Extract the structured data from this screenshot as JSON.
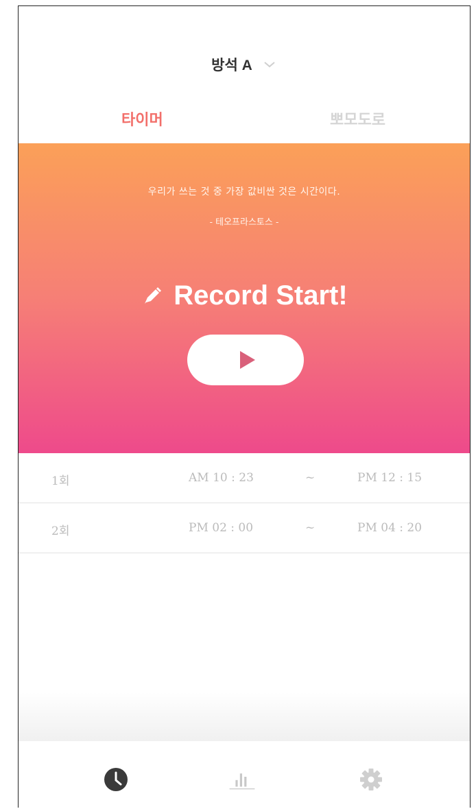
{
  "header": {
    "title": "방석 A",
    "tabs": [
      {
        "label": "타이머",
        "active": true
      },
      {
        "label": "뽀모도로",
        "active": false
      }
    ]
  },
  "hero": {
    "quote": "우리가 쓰는 것 중 가장 값비싼 것은 시간이다.",
    "author": "- 테오프라스토스 -",
    "record_label": "Record Start!",
    "play_icon": "play-icon",
    "gradient": [
      "#fba058",
      "#ee4a8b"
    ]
  },
  "records": [
    {
      "index": "1회",
      "start": "AM 10 : 23",
      "separator": "~",
      "end": "PM 12 : 15"
    },
    {
      "index": "2회",
      "start": "PM 02 : 00",
      "separator": "~",
      "end": "PM 04 : 20"
    }
  ],
  "bottom_nav": [
    {
      "icon": "clock-icon",
      "active": true
    },
    {
      "icon": "bar-chart-icon",
      "active": false
    },
    {
      "icon": "gear-icon",
      "active": false
    }
  ],
  "colors": {
    "accent": "#f26f6a",
    "inactive_tab": "#d5d5d5",
    "play_triangle": "#d9607a"
  }
}
